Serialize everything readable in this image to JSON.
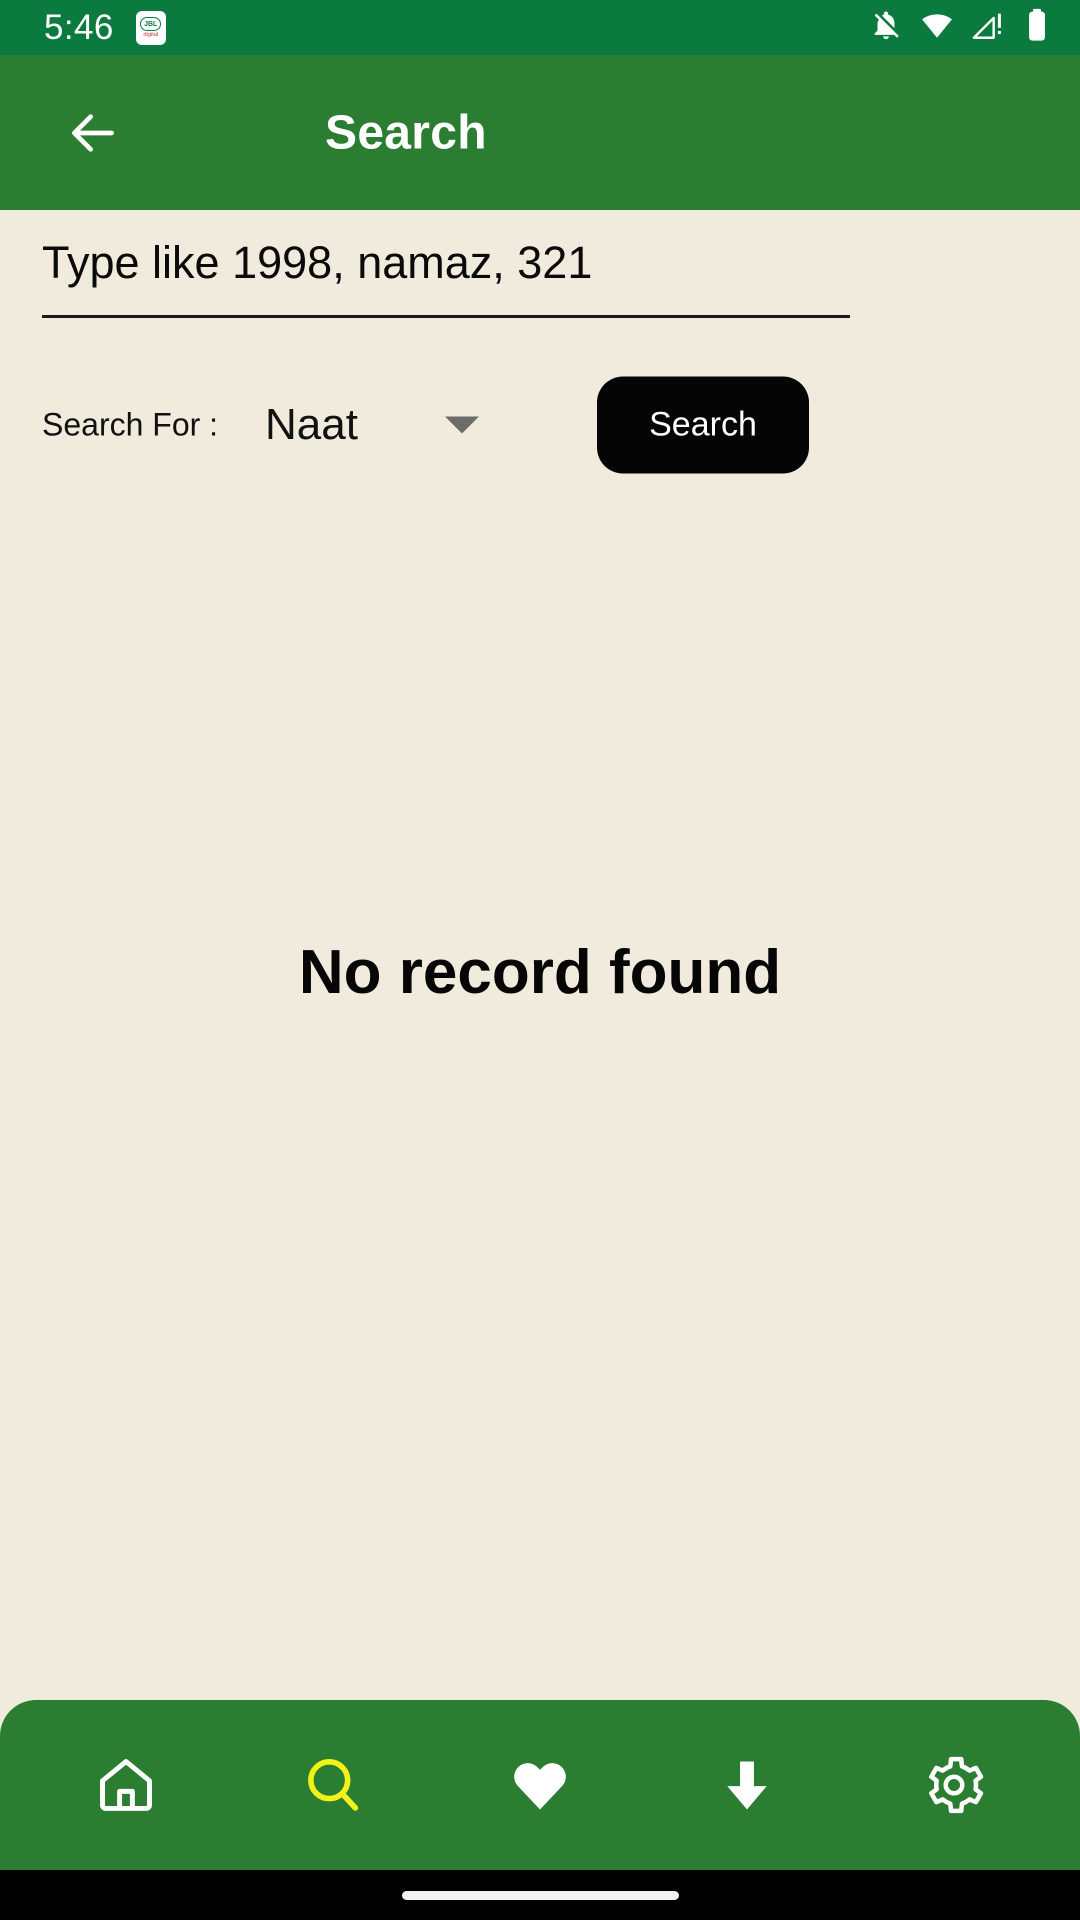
{
  "status_bar": {
    "time": "5:46",
    "notification_icon": {
      "name": "jbl-digital-app-icon",
      "brand": "JBL",
      "sub_label": "digital"
    },
    "icons": [
      {
        "name": "notifications-off-icon",
        "label": "Notifications silenced"
      },
      {
        "name": "wifi-icon",
        "label": "Wi-Fi connected"
      },
      {
        "name": "cellular-no-sim-icon",
        "label": "No SIM / no signal"
      },
      {
        "name": "battery-icon",
        "label": "Battery full"
      }
    ],
    "background_color": "#0B7A3E",
    "foreground_color": "#FFFFFF"
  },
  "app_bar": {
    "back_label": "Back",
    "title": "Search",
    "background_color": "#2B7D32",
    "title_color": "#FFFFFF"
  },
  "search_form": {
    "input_value": "",
    "input_placeholder": "Type like 1998, namaz, 321",
    "search_for_label": "Search For :",
    "category_selected": "Naat",
    "category_options": [
      "Naat"
    ],
    "submit_label": "Search",
    "submit_bg_color": "#050505",
    "submit_text_color": "#FFFFFF"
  },
  "results": {
    "empty_message": "No record found"
  },
  "bottom_nav": {
    "background_color": "#2B7D32",
    "active_color": "#F2F21A",
    "inactive_color": "#FFFFFF",
    "items": [
      {
        "name": "nav-home",
        "icon": "home-icon",
        "label": "Home",
        "active": false
      },
      {
        "name": "nav-search",
        "icon": "search-icon",
        "label": "Search",
        "active": true
      },
      {
        "name": "nav-favorites",
        "icon": "heart-icon",
        "label": "Favorites",
        "active": false
      },
      {
        "name": "nav-downloads",
        "icon": "download-arrow-icon",
        "label": "Downloads",
        "active": false
      },
      {
        "name": "nav-settings",
        "icon": "gear-icon",
        "label": "Settings",
        "active": false
      }
    ]
  },
  "system_nav": {
    "gesture_pill": "home gesture bar",
    "background_color": "#000000"
  },
  "theme": {
    "page_background": "#F0EBDC",
    "text_primary": "#060606"
  }
}
